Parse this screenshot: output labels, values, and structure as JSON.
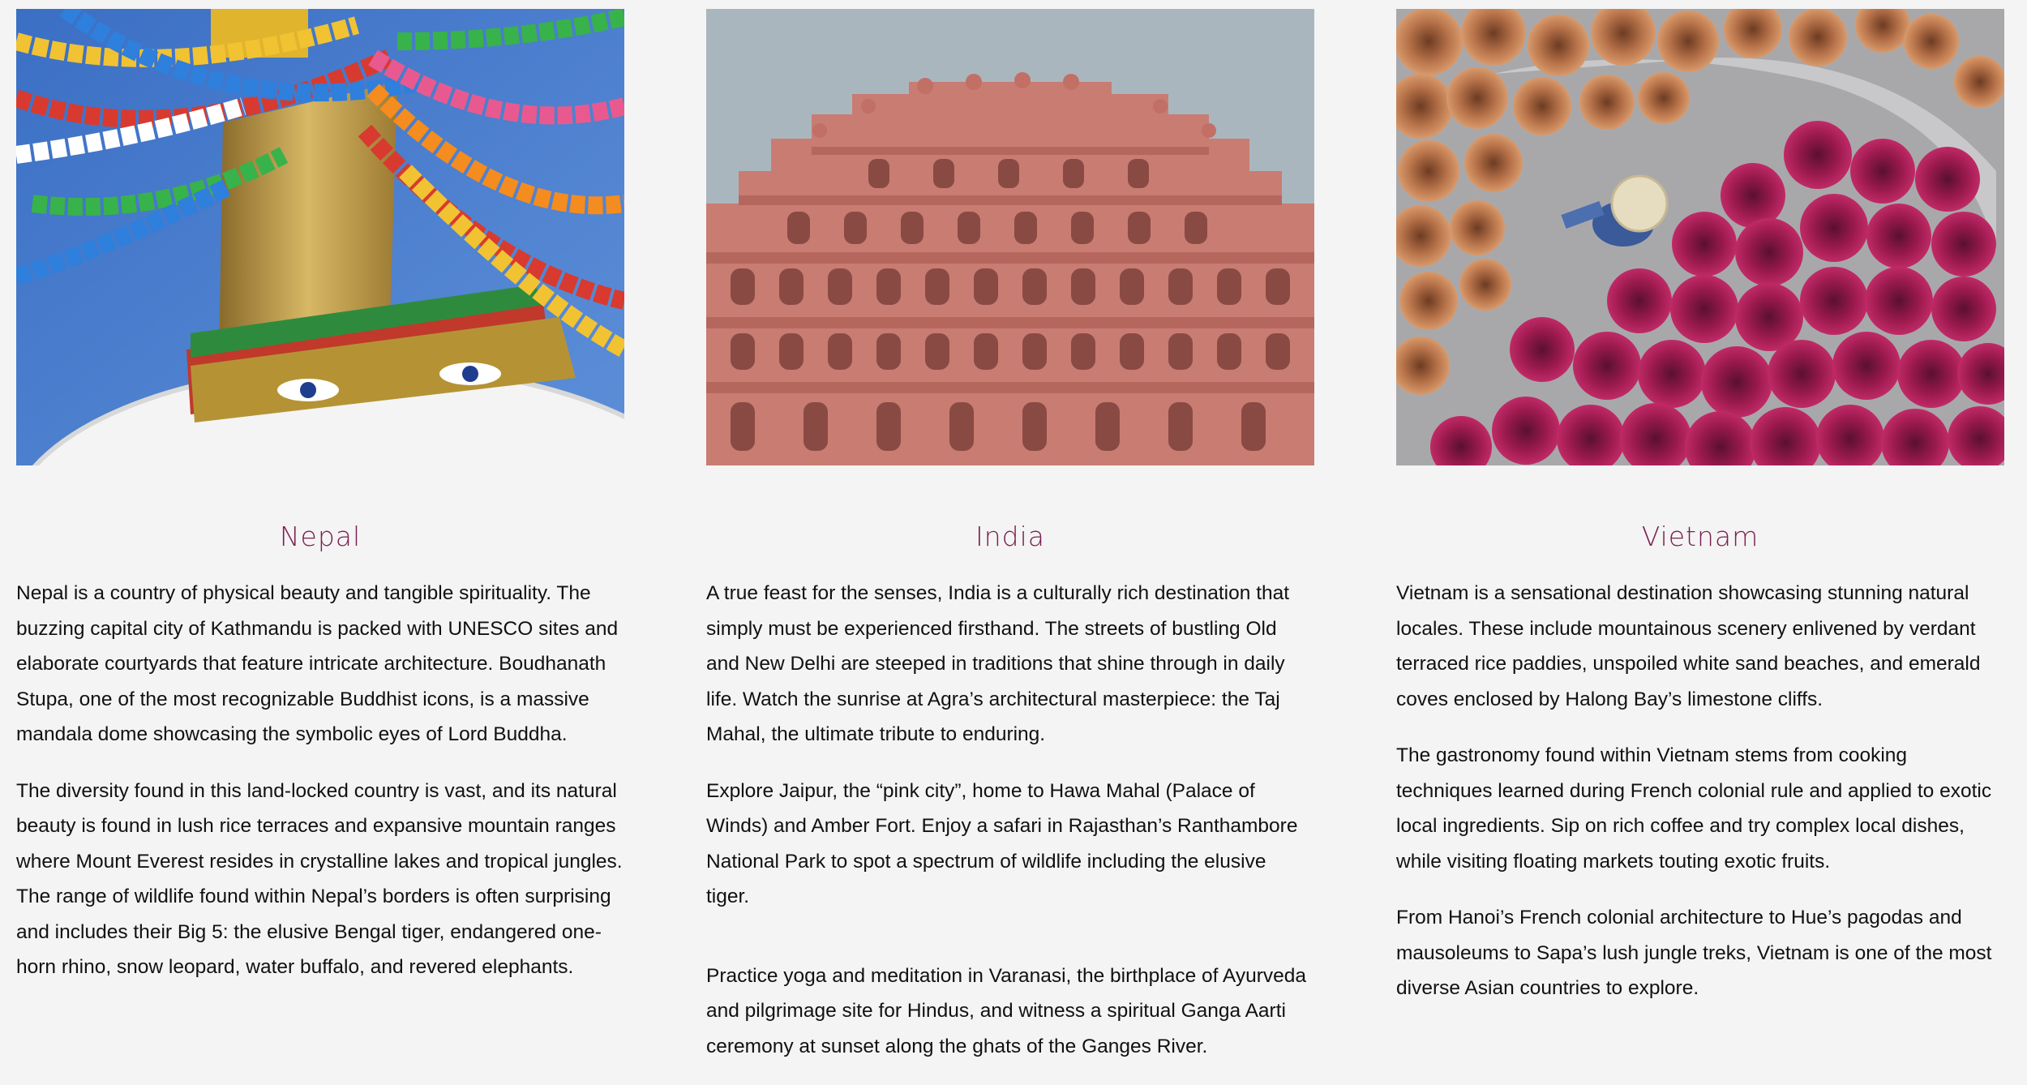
{
  "destinations": [
    {
      "photo_icon": "stupa-prayer-flags-photo",
      "name": "Nepal",
      "paragraphs": [
        "Nepal is a country of physical beauty and tangible spirituality. The buzzing capital city of Kathmandu is packed with UNESCO sites and elaborate courtyards that feature intricate architecture. Boudhanath Stupa, one of the most recognizable Buddhist icons, is a massive mandala dome showcasing the symbolic eyes of Lord Buddha.",
        "The diversity found in this land-locked country is vast, and its natural beauty is found in lush rice terraces and expansive mountain ranges where Mount Everest resides in crystalline lakes and tropical jungles. The range of wildlife found within Nepal’s borders is often surprising and includes their Big 5: the elusive Bengal tiger, endangered one-horn rhino, snow leopard, water buffalo, and revered elephants."
      ]
    },
    {
      "photo_icon": "hawa-mahal-palace-photo",
      "name": "India",
      "paragraphs": [
        "A true feast for the senses, India is a culturally rich destination that simply must be experienced firsthand. The streets of bustling Old and New Delhi are steeped in traditions that shine through in daily life. Watch the sunrise at Agra’s architectural masterpiece: the Taj Mahal, the ultimate tribute to enduring.",
        "Explore Jaipur, the “pink city”, home to Hawa Mahal (Palace of Winds) and Amber Fort.  Enjoy a safari in Rajasthan’s Ranthambore National Park to spot a spectrum of wildlife including the elusive tiger.",
        "Practice yoga and meditation in Varanasi, the birthplace of Ayurveda and pilgrimage site for Hindus, and witness a spiritual Ganga Aarti ceremony at sunset along the ghats of the Ganges River."
      ]
    },
    {
      "photo_icon": "incense-sticks-drying-photo",
      "name": "Vietnam",
      "paragraphs": [
        "Vietnam is a sensational destination showcasing stunning natural locales. These include mountainous scenery enlivened by verdant terraced rice paddies, unspoiled white sand beaches, and emerald coves enclosed by Halong Bay’s limestone cliffs.",
        "The gastronomy found within Vietnam stems from cooking techniques learned during French colonial rule and applied to exotic local ingredients. Sip on rich coffee and try complex local dishes, while visiting floating markets touting exotic fruits.",
        "From Hanoi’s French colonial architecture to Hue’s pagodas and mausoleums to Sapa’s lush jungle treks, Vietnam is one of the most diverse Asian countries to explore."
      ]
    }
  ],
  "colors": {
    "background": "#f4f4f4",
    "title": "#7a1f4f",
    "body_text": "#111111"
  }
}
